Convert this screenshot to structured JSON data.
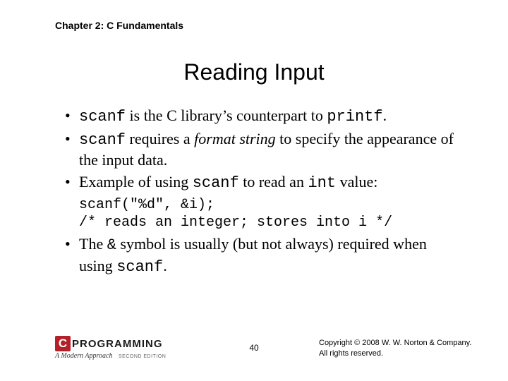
{
  "chapter": "Chapter 2: C Fundamentals",
  "title": "Reading Input",
  "bullets": {
    "b1_pre": "scanf",
    "b1_mid": " is the C library’s counterpart to ",
    "b1_post": "printf",
    "b1_end": ".",
    "b2_pre": "scanf",
    "b2_mid1": " requires a ",
    "b2_em": "format string",
    "b2_mid2": " to specify the appearance of the input data.",
    "b3_pre": "Example of using ",
    "b3_code1": "scanf",
    "b3_mid": " to read an ",
    "b3_code2": "int",
    "b3_end": " value:",
    "b4_pre": "The ",
    "b4_code": "&",
    "b4_mid": " symbol is usually (but not always) required when using ",
    "b4_code2": "scanf",
    "b4_end": "."
  },
  "codeblock": "scanf(\"%d\", &i);\n/* reads an integer; stores into i */",
  "logo": {
    "c": "C",
    "word": "PROGRAMMING",
    "sub": "A Modern Approach",
    "edition": "SECOND EDITION"
  },
  "page": "40",
  "copyright_line1": "Copyright © 2008 W. W. Norton & Company.",
  "copyright_line2": "All rights reserved."
}
